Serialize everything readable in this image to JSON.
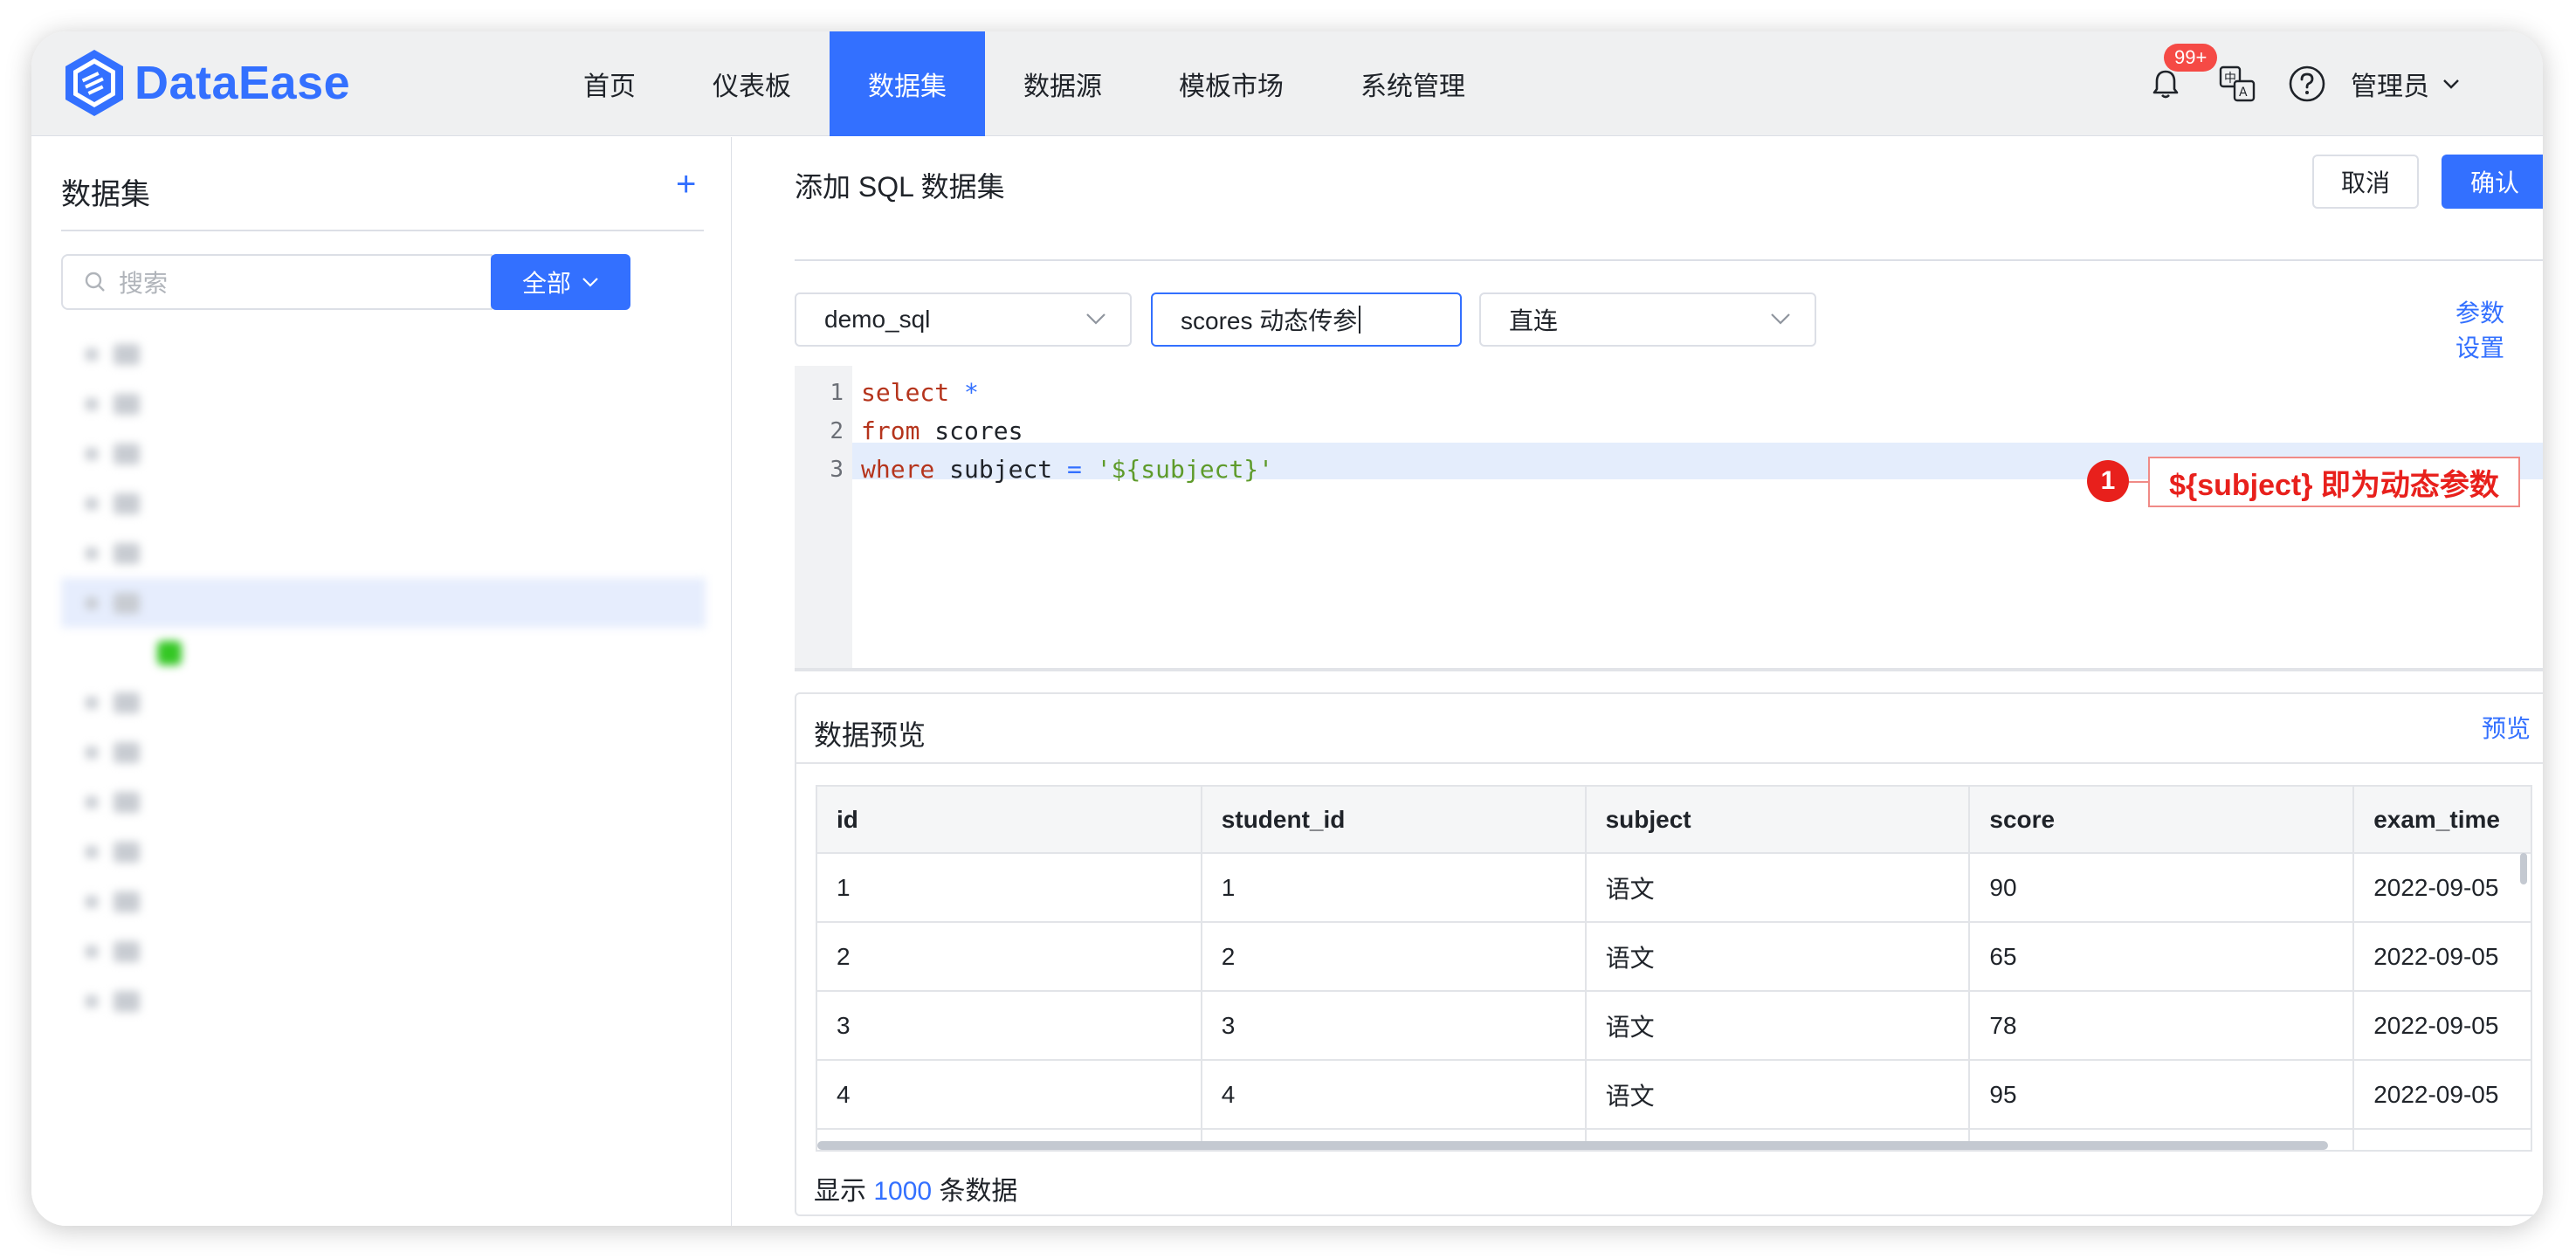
{
  "app": {
    "name": "DataEase"
  },
  "nav": {
    "items": [
      "首页",
      "仪表板",
      "数据集",
      "数据源",
      "模板市场",
      "系统管理"
    ],
    "active_index": 2
  },
  "header": {
    "notification_badge": "99+",
    "user": "管理员",
    "icons": [
      "bell-icon",
      "language-icon",
      "help-icon",
      "chevron-down-icon"
    ]
  },
  "sidebar": {
    "title": "数据集",
    "add_symbol": "+",
    "search_placeholder": "搜索",
    "scope_label": "全部",
    "tree": [
      {
        "label": "",
        "level": 0,
        "selected": false
      },
      {
        "label": "",
        "level": 0,
        "selected": false
      },
      {
        "label": "",
        "level": 0,
        "selected": false
      },
      {
        "label": "",
        "level": 0,
        "selected": false
      },
      {
        "label": "",
        "level": 0,
        "selected": false
      },
      {
        "label": "",
        "level": 0,
        "selected": true
      },
      {
        "label": "",
        "level": 1,
        "selected": false
      },
      {
        "label": "",
        "level": 0,
        "selected": false
      },
      {
        "label": "",
        "level": 0,
        "selected": false
      },
      {
        "label": "",
        "level": 0,
        "selected": false
      },
      {
        "label": "",
        "level": 0,
        "selected": false
      },
      {
        "label": "",
        "level": 0,
        "selected": false
      },
      {
        "label": "",
        "level": 0,
        "selected": false
      },
      {
        "label": "",
        "level": 0,
        "selected": false
      }
    ]
  },
  "main": {
    "title": "添加 SQL 数据集",
    "cancel": "取消",
    "confirm": "确认",
    "datasource": "demo_sql",
    "dataset_name": "scores 动态传参",
    "mode": "直连",
    "param_settings": "参数设置",
    "code_lines": [
      [
        {
          "t": "select",
          "c": "kw"
        },
        {
          "t": " "
        },
        {
          "t": "*",
          "c": "op"
        }
      ],
      [
        {
          "t": "from",
          "c": "kw"
        },
        {
          "t": " scores"
        }
      ],
      [
        {
          "t": "where",
          "c": "kw"
        },
        {
          "t": " subject "
        },
        {
          "t": "=",
          "c": "op"
        },
        {
          "t": " "
        },
        {
          "t": "'${subject}'",
          "c": "str"
        }
      ]
    ],
    "callout": {
      "number": "1",
      "text": "${subject} 即为动态参数"
    }
  },
  "preview": {
    "title": "数据预览",
    "link": "预览",
    "columns": [
      "id",
      "student_id",
      "subject",
      "score",
      "exam_time"
    ],
    "rows": [
      [
        "1",
        "1",
        "语文",
        "90",
        "2022-09-05 "
      ],
      [
        "2",
        "2",
        "语文",
        "65",
        "2022-09-05 "
      ],
      [
        "3",
        "3",
        "语文",
        "78",
        "2022-09-05 "
      ],
      [
        "4",
        "4",
        "语文",
        "95",
        "2022-09-05 "
      ],
      [
        "",
        "",
        "",
        "",
        ""
      ]
    ],
    "footer_prefix": "显示",
    "footer_count": "1000",
    "footer_suffix": "条数据"
  }
}
